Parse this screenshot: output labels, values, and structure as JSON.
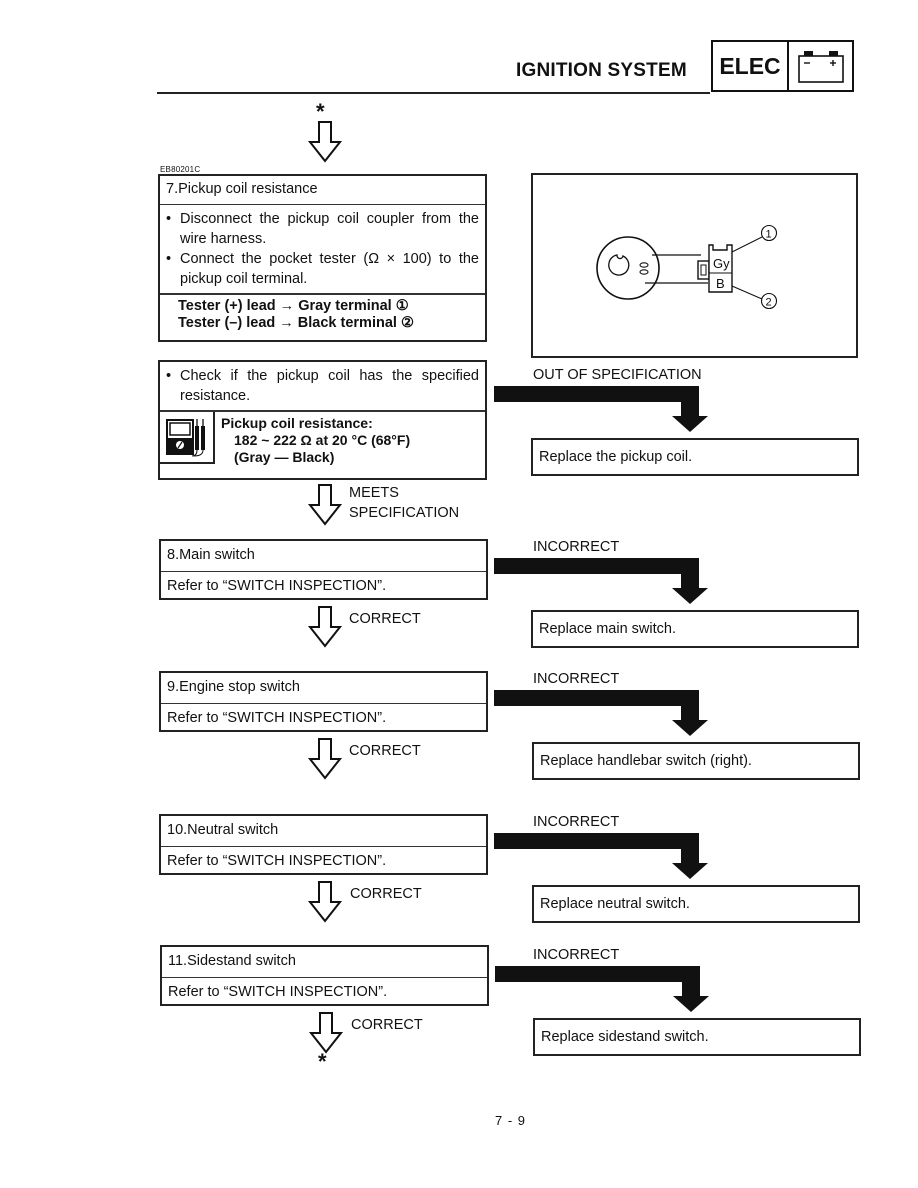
{
  "header": {
    "section_title": "IGNITION SYSTEM",
    "chapter_tag": "ELEC",
    "chapter_icon": "battery-icon",
    "battery_minus": "−",
    "battery_plus": "+"
  },
  "connector_top": "*",
  "connector_bottom": "*",
  "reference_code": "EB80201C",
  "step7": {
    "title": "7.Pickup coil resistance",
    "instructions": [
      "Disconnect the pickup coil coupler from the wire harness.",
      "Connect the pocket tester (Ω × 100) to the pickup coil terminal."
    ],
    "tester_leads": [
      "Tester (+) lead → Gray terminal ①",
      "Tester (–) lead → Black terminal ②"
    ],
    "check": "Check if the pickup coil has the specified resistance.",
    "spec_icon": "pocket-tester-icon",
    "spec_title": "Pickup coil resistance:",
    "spec_value": "182 ~ 222 Ω at 20 °C (68°F)",
    "spec_wires": "(Gray — Black)",
    "pass_label_line1": "MEETS",
    "pass_label_line2": "SPECIFICATION",
    "fail_label": "OUT OF SPECIFICATION",
    "fail_action": "Replace the pickup coil.",
    "diagram": {
      "terminal_1_label": "Gy",
      "terminal_2_label": "B",
      "callout_1": "1",
      "callout_2": "2"
    }
  },
  "steps": [
    {
      "title": "8.Main switch",
      "instruction": "Refer to “SWITCH INSPECTION”.",
      "pass_label": "CORRECT",
      "fail_label": "INCORRECT",
      "fail_action": "Replace main switch."
    },
    {
      "title": "9.Engine stop switch",
      "instruction": "Refer to “SWITCH INSPECTION”.",
      "pass_label": "CORRECT",
      "fail_label": "INCORRECT",
      "fail_action": "Replace handlebar switch (right)."
    },
    {
      "title": "10.Neutral switch",
      "instruction": "Refer to “SWITCH INSPECTION”.",
      "pass_label": "CORRECT",
      "fail_label": "INCORRECT",
      "fail_action": "Replace neutral switch."
    },
    {
      "title": "11.Sidestand switch",
      "instruction": "Refer to “SWITCH INSPECTION”.",
      "pass_label": "CORRECT",
      "fail_label": "INCORRECT",
      "fail_action": "Replace sidestand switch."
    }
  ],
  "page_number": "7 - 9"
}
